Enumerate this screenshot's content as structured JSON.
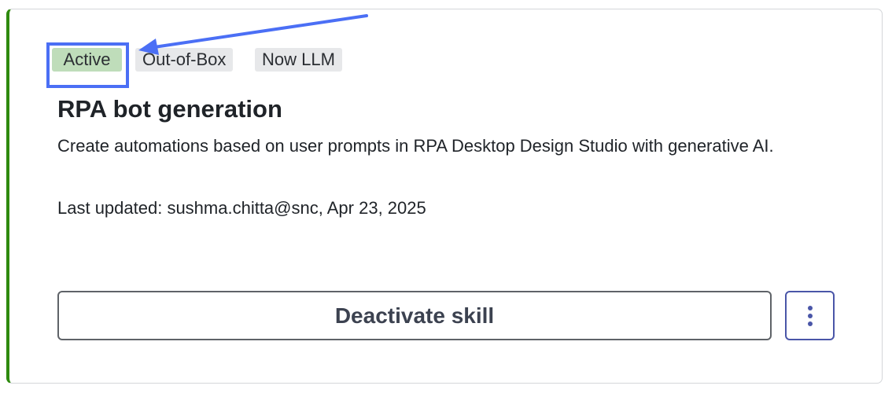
{
  "card": {
    "accent_color": "#2e8a0e",
    "tags": {
      "active": "Active",
      "out_of_box": "Out-of-Box",
      "now_llm": "Now LLM"
    },
    "title": "RPA bot generation",
    "description": "Create automations based on user prompts in RPA Desktop Design Studio with generative AI.",
    "last_updated": "Last updated: sushma.chitta@snc, Apr 23, 2025",
    "primary_button_label": "Deactivate skill",
    "more_button_icon": "vertical-ellipsis-icon"
  },
  "annotation": {
    "color": "#4b6ff5"
  }
}
